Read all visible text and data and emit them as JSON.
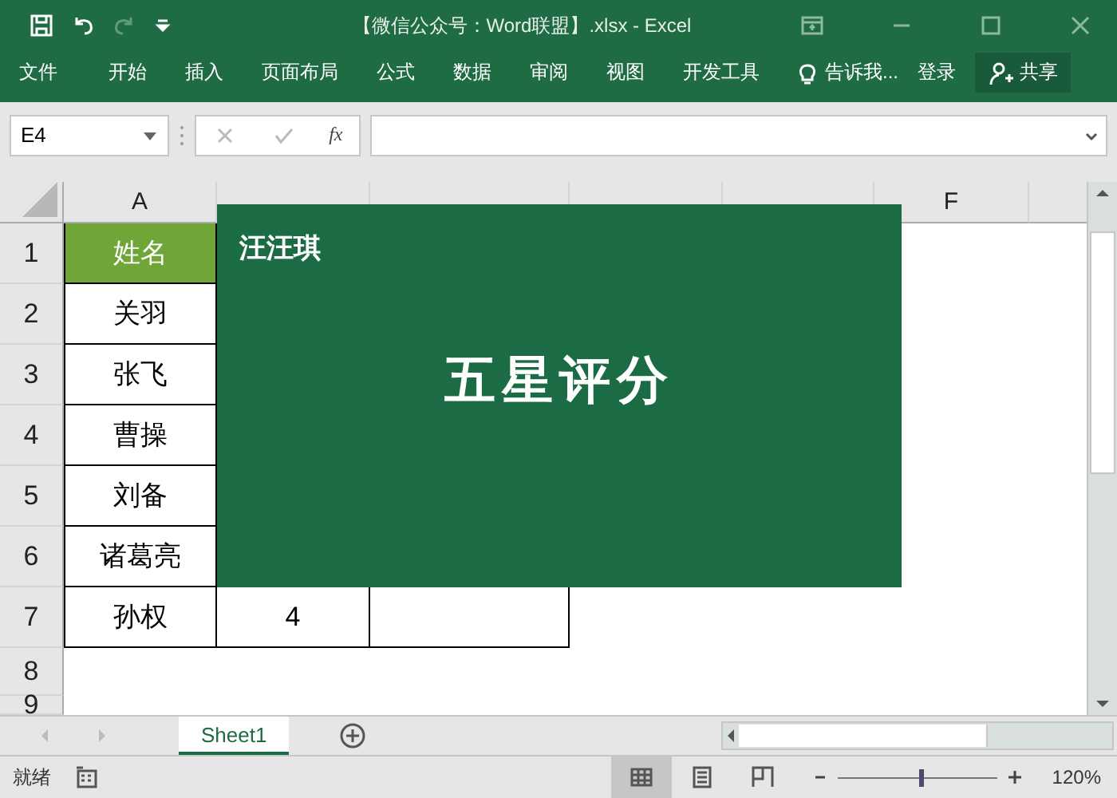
{
  "window": {
    "title": "【微信公众号：Word联盟】.xlsx - Excel"
  },
  "ribbon": {
    "tabs": [
      {
        "label": "文件",
        "selected": false
      },
      {
        "label": "开始",
        "selected": false
      },
      {
        "label": "插入",
        "selected": false
      },
      {
        "label": "页面布局",
        "selected": false
      },
      {
        "label": "公式",
        "selected": false
      },
      {
        "label": "数据",
        "selected": false
      },
      {
        "label": "审阅",
        "selected": false
      },
      {
        "label": "视图",
        "selected": false
      },
      {
        "label": "开发工具",
        "selected": false
      }
    ],
    "tell_me": "告诉我...",
    "sign_in": "登录",
    "share": "共享"
  },
  "formula_bar": {
    "name_box": "E4",
    "fx": "fx"
  },
  "sheet": {
    "columns": [
      {
        "label": "A",
        "covered": false
      },
      {
        "covered": true
      },
      {
        "covered": true
      },
      {
        "covered": true
      },
      {
        "covered": true
      },
      {
        "label": "F",
        "covered": false
      }
    ],
    "rows": [
      {
        "number": "1",
        "cells": [
          "姓名"
        ]
      },
      {
        "number": "2",
        "cells": [
          "关羽"
        ]
      },
      {
        "number": "3",
        "cells": [
          "张飞"
        ]
      },
      {
        "number": "4",
        "cells": [
          "曹操"
        ]
      },
      {
        "number": "5",
        "cells": [
          "刘备"
        ]
      },
      {
        "number": "6",
        "cells": [
          "诸葛亮"
        ]
      },
      {
        "number": "7",
        "cells": [
          "孙权",
          "4"
        ]
      },
      {
        "number": "8",
        "cells": []
      },
      {
        "number": "9",
        "cells": []
      }
    ],
    "overlay": {
      "author": "汪汪琪",
      "title": "五星评分"
    }
  },
  "sheet_tabs": [
    {
      "label": "Sheet1",
      "selected": true
    }
  ],
  "status_bar": {
    "status": "就绪",
    "views": [
      {
        "kind": "normal",
        "selected": true
      },
      {
        "kind": "layout",
        "selected": false
      },
      {
        "kind": "break",
        "selected": false
      }
    ],
    "zoom": {
      "level": 0.52,
      "reading": "120%"
    }
  }
}
